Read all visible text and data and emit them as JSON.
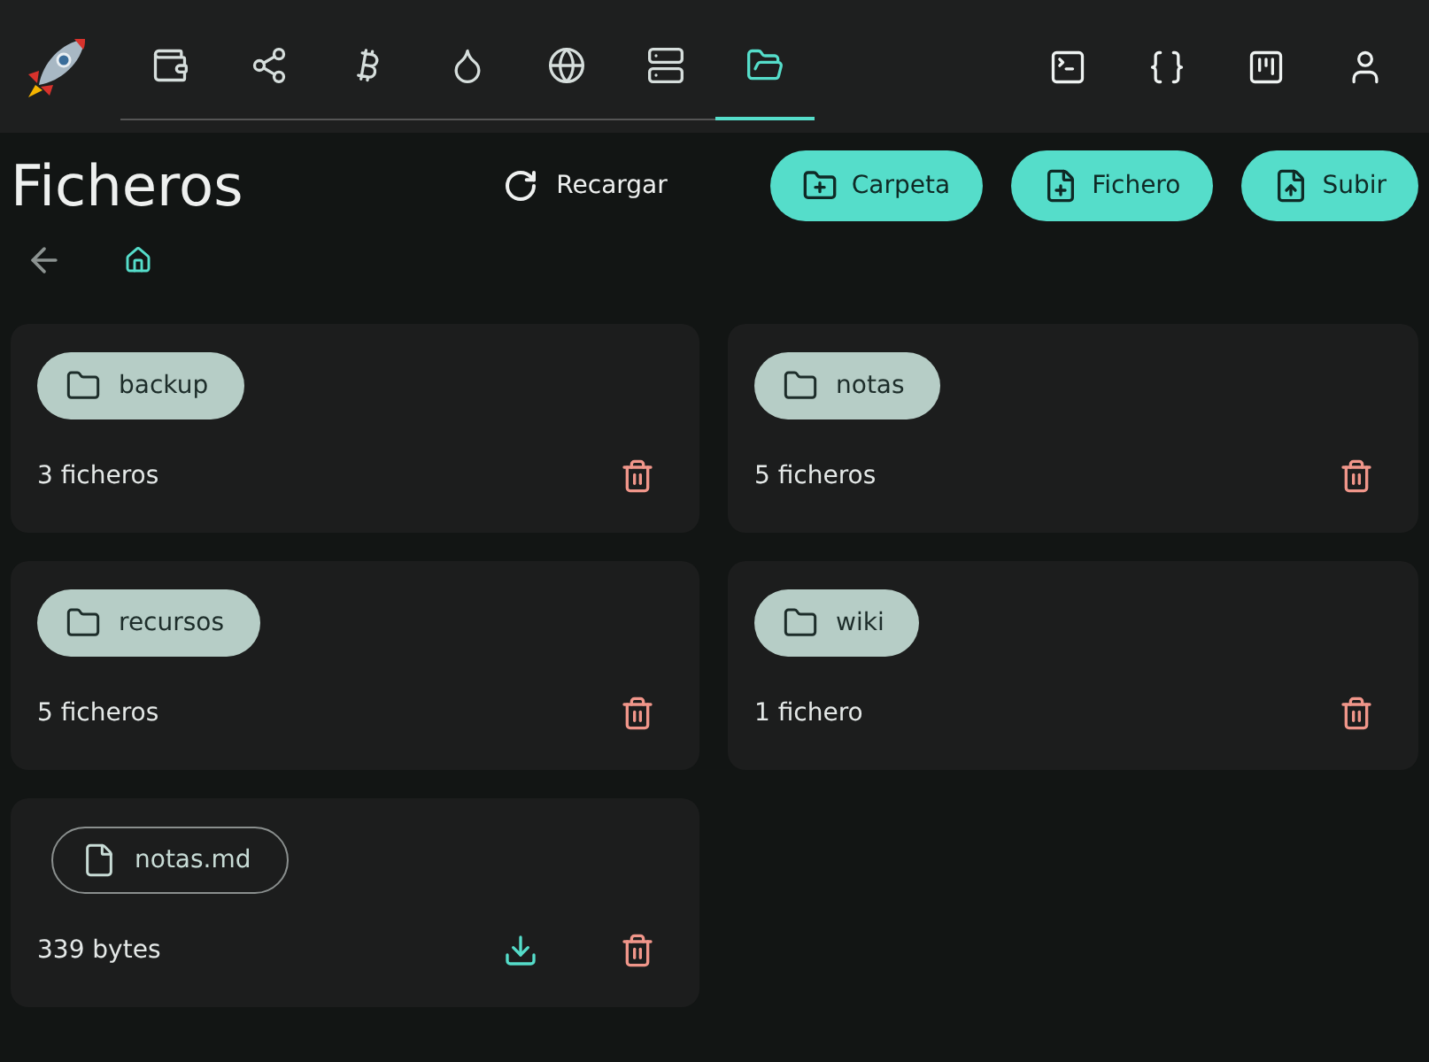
{
  "nav": {
    "items": [
      {
        "kind": "wallet",
        "selected": false
      },
      {
        "kind": "share",
        "selected": false
      },
      {
        "kind": "bitcoin",
        "selected": false
      },
      {
        "kind": "droplet",
        "selected": false
      },
      {
        "kind": "globe",
        "selected": false
      },
      {
        "kind": "server",
        "selected": false
      },
      {
        "kind": "folder",
        "selected": true
      }
    ],
    "tools": [
      {
        "kind": "terminal"
      },
      {
        "kind": "braces"
      },
      {
        "kind": "kanban"
      },
      {
        "kind": "user"
      }
    ]
  },
  "title": "Ficheros",
  "reload": {
    "label": "Recargar"
  },
  "actions": [
    {
      "kind": "folder",
      "label": "Carpeta"
    },
    {
      "kind": "file",
      "label": "Fichero"
    },
    {
      "kind": "upload",
      "label": "Subir"
    }
  ],
  "entries": [
    {
      "kind": "folder",
      "name": "backup",
      "info": "3 ficheros"
    },
    {
      "kind": "folder",
      "name": "notas",
      "info": "5 ficheros"
    },
    {
      "kind": "folder",
      "name": "recursos",
      "info": "5 ficheros"
    },
    {
      "kind": "folder",
      "name": "wiki",
      "info": "1 fichero"
    },
    {
      "kind": "file",
      "name": "notas.md",
      "info": "339 bytes"
    }
  ]
}
